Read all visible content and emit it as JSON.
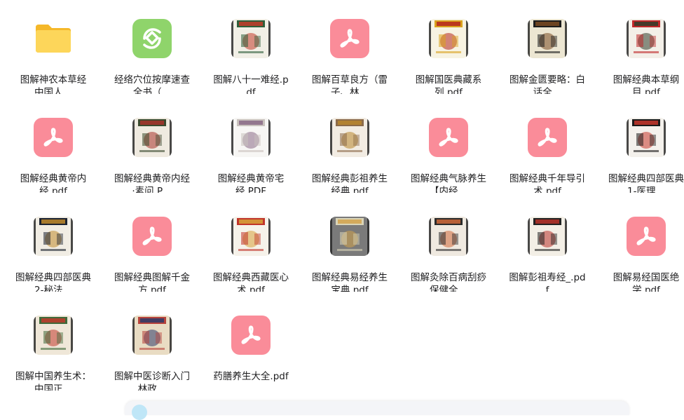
{
  "files": [
    {
      "name": "图解神农本草经 中国人…",
      "kind": "folder"
    },
    {
      "name": "经络穴位按摩速查全书（…",
      "kind": "ebook"
    },
    {
      "name": "图解八十一难经.pdf",
      "kind": "cover"
    },
    {
      "name": "图解百草良方（雷子、林…",
      "kind": "pdf"
    },
    {
      "name": "图解国医典藏系列.pdf",
      "kind": "cover"
    },
    {
      "name": "图解金匮要略：白话全…",
      "kind": "cover"
    },
    {
      "name": "图解经典本草纲目.pdf",
      "kind": "cover"
    },
    {
      "name": "图解经典黄帝内经.pdf",
      "kind": "pdf"
    },
    {
      "name": "图解经典黄帝内经·素问.P…",
      "kind": "cover"
    },
    {
      "name": "图解经典黄帝宅经.PDF",
      "kind": "cover"
    },
    {
      "name": "图解经典彭祖养生经典.pdf",
      "kind": "cover"
    },
    {
      "name": "图解经典气脉养生【内经…",
      "kind": "pdf"
    },
    {
      "name": "图解经典千年导引术.pdf",
      "kind": "pdf"
    },
    {
      "name": "图解经典四部医典1-医理…",
      "kind": "cover"
    },
    {
      "name": "图解经典四部医典2-秘法…",
      "kind": "cover"
    },
    {
      "name": "图解经典图解千金方.pdf",
      "kind": "pdf"
    },
    {
      "name": "图解经典西藏医心术.pdf",
      "kind": "cover"
    },
    {
      "name": "图解经典易经养生宝典.pdf",
      "kind": "cover"
    },
    {
      "name": "图解灸除百病刮痧保健全…",
      "kind": "cover"
    },
    {
      "name": "图解彭祖寿经_.pdf",
      "kind": "cover"
    },
    {
      "name": "图解易经国医绝学.pdf",
      "kind": "pdf"
    },
    {
      "name": "图解中国养生术：中国正…",
      "kind": "cover"
    },
    {
      "name": "图解中医诊断入门 林政…",
      "kind": "cover"
    },
    {
      "name": "药膳养生大全.pdf",
      "kind": "pdf"
    }
  ],
  "covers": {
    "2": {
      "bg": "#f1efe6",
      "band": "#2e5e3a",
      "accent": "#c33b2a",
      "title": "八十一难经"
    },
    "4": {
      "bg": "#f7f3e2",
      "band": "#d9a21e",
      "accent": "#b5261e",
      "title": "国医典藏"
    },
    "5": {
      "bg": "#ece6d2",
      "band": "#1d1d1d",
      "accent": "#7a4a22",
      "title": "金匮要略"
    },
    "6": {
      "bg": "#f3efe8",
      "band": "#c0282a",
      "accent": "#2f3c2a",
      "title": "本草纲目"
    },
    "8": {
      "bg": "#efeae0",
      "band": "#3b4a2e",
      "accent": "#a8322a",
      "title": "素问"
    },
    "9": {
      "bg": "#f7f6f4",
      "band": "#c9c2bd",
      "accent": "#8a6a86",
      "title": "黄帝宅经"
    },
    "10": {
      "bg": "#f2ece3",
      "band": "#8c6b4a",
      "accent": "#b8862e",
      "title": "彭祖"
    },
    "13": {
      "bg": "#f4f1ec",
      "band": "#1b1b1b",
      "accent": "#c7362b",
      "title": "四部医典"
    },
    "14": {
      "bg": "#f1ede4",
      "band": "#1c2331",
      "accent": "#c08a2c",
      "title": "四部医典"
    },
    "16": {
      "bg": "#f6f2ea",
      "band": "#c1342a",
      "accent": "#d7a33a",
      "title": "西藏医心术"
    },
    "17": {
      "bg": "#7a7a7a",
      "band": "#d9d4b8",
      "accent": "#d1a24b",
      "title": "易经"
    },
    "18": {
      "bg": "#efe9e0",
      "band": "#2b2b2b",
      "accent": "#d06a3a",
      "title": "灸除百病"
    },
    "19": {
      "bg": "#f3efe6",
      "band": "#222222",
      "accent": "#b8322a",
      "title": "彭祖寿经"
    },
    "21": {
      "bg": "#efe7d8",
      "band": "#3f6a3a",
      "accent": "#c13b2d",
      "title": "中国养生术"
    },
    "22": {
      "bg": "#e9dcc3",
      "band": "#b7423b",
      "accent": "#2e3b6a",
      "title": "中医诊断"
    }
  },
  "colors": {
    "pdf": "#fa8c99",
    "folder": "#fcd04f",
    "ebook": "#8fd46b"
  }
}
